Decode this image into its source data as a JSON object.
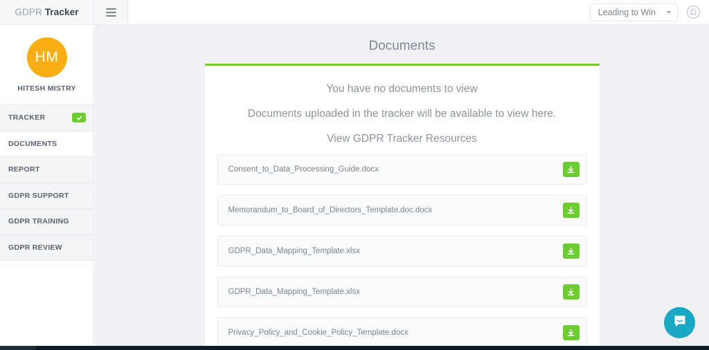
{
  "topbar": {
    "brand_light": "GDPR",
    "brand_bold": "Tracker",
    "menu_icon": "hamburger-icon",
    "org_selected": "Leading to Win",
    "account_icon": "account-circle-icon"
  },
  "sidebar": {
    "avatar_initials": "HM",
    "username": "HITESH MISTRY",
    "items": [
      {
        "label": "TRACKER",
        "active": false,
        "badge": "check"
      },
      {
        "label": "DOCUMENTS",
        "active": true,
        "badge": ""
      },
      {
        "label": "REPORT",
        "active": false,
        "badge": ""
      },
      {
        "label": "GDPR SUPPORT",
        "active": false,
        "badge": ""
      },
      {
        "label": "GDPR TRAINING",
        "active": false,
        "badge": ""
      },
      {
        "label": "GDPR REVIEW",
        "active": false,
        "badge": ""
      }
    ]
  },
  "main": {
    "title": "Documents",
    "empty_heading": "You have no documents to view",
    "empty_subtext": "Documents uploaded in the tracker will be available to view here.",
    "resources_title": "View GDPR Tracker Resources",
    "documents": [
      {
        "name": "Consent_to_Data_Processing_Guide.docx"
      },
      {
        "name": "Memorandum_to_Board_of_Directors_Template.doc.docx"
      },
      {
        "name": "GDPR_Data_Mapping_Template.xlsx"
      },
      {
        "name": "GDPR_Data_Mapping_Template.xlsx"
      },
      {
        "name": "Privacy_Policy_and_Cookie_Policy_Template.docx"
      }
    ],
    "download_icon": "download-icon"
  },
  "chat": {
    "icon": "chat-bubble-icon"
  },
  "colors": {
    "accent_green": "#6ccc31",
    "avatar_orange": "#f9ae15",
    "chat_teal": "#1ba8c4",
    "page_bg": "#eff1f5"
  }
}
